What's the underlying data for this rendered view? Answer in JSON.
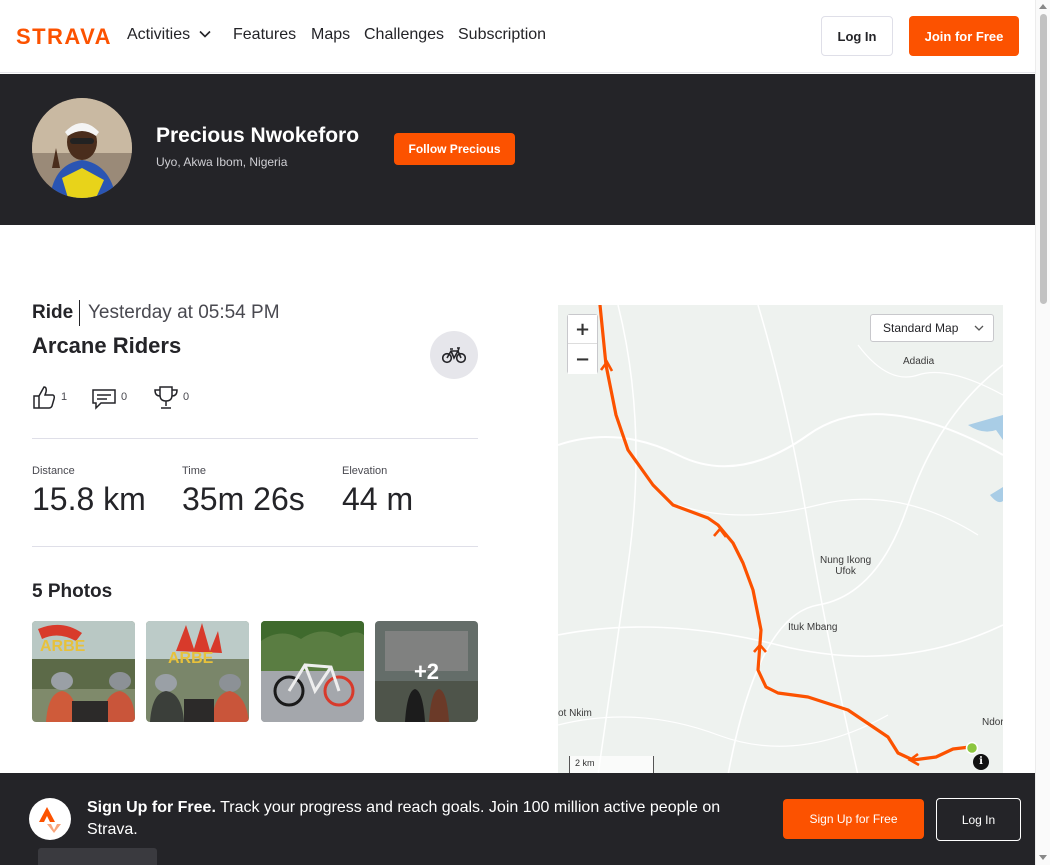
{
  "header": {
    "logo_text": "STRAVA",
    "nav": [
      {
        "label": "Activities",
        "has_dropdown": true
      },
      {
        "label": "Features"
      },
      {
        "label": "Maps"
      },
      {
        "label": "Challenges"
      },
      {
        "label": "Subscription"
      }
    ],
    "login_label": "Log In",
    "join_label": "Join for Free"
  },
  "athlete": {
    "name": "Precious Nwokeforo",
    "location": "Uyo, Akwa Ibom, Nigeria",
    "follow_label": "Follow Precious"
  },
  "activity": {
    "type": "Ride",
    "date": "Yesterday at 05:54 PM",
    "title": "Arcane Riders",
    "sport_icon": "bike-icon",
    "kudos": "1",
    "comments": "0",
    "achievements": "0",
    "stats": [
      {
        "label": "Distance",
        "value": "15.8 km"
      },
      {
        "label": "Time",
        "value": "35m 26s"
      },
      {
        "label": "Elevation",
        "value": "44 m"
      }
    ],
    "photos_title": "5 Photos",
    "photos_more": "+2"
  },
  "map": {
    "type_selector": "Standard Map",
    "zoom_in": "+",
    "zoom_out": "−",
    "labels": [
      "Adadia",
      "Nung Ikong",
      "Ufok",
      "Ituk Mbang",
      "ot Nkim",
      "Ndor"
    ],
    "scale": "2 km",
    "info": "i",
    "route_color": "#fc5200",
    "start_color": "#8cc63f"
  },
  "signup": {
    "headline": "Sign Up for Free.",
    "text": "Track your progress and reach goals. Join 100 million active people on Strava.",
    "signup_label": "Sign Up for Free",
    "login_label": "Log In"
  },
  "colors": {
    "brand": "#fc5200",
    "dark": "#242428"
  }
}
